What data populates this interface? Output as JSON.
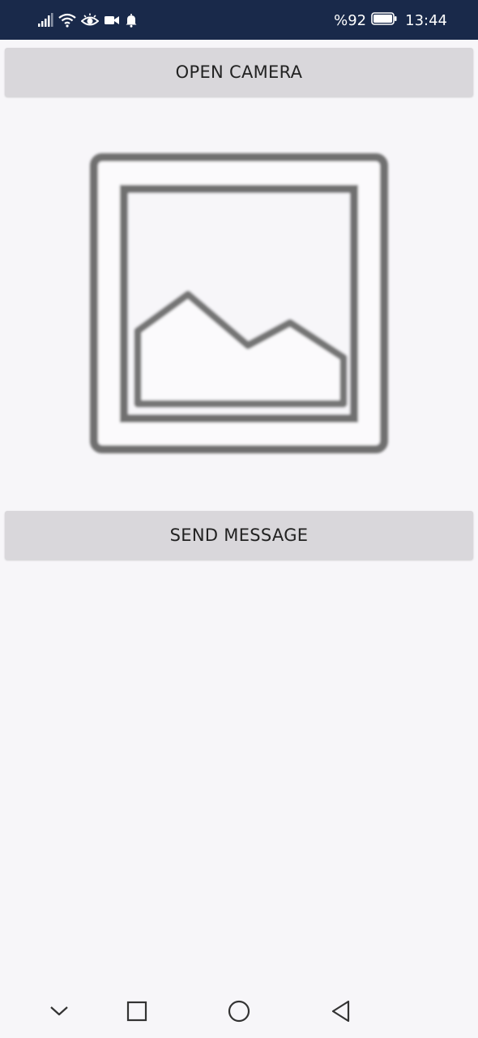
{
  "status_bar": {
    "battery_percent": "%92",
    "time": "13:44",
    "background_color": "#19294a",
    "icons": [
      "signal-icon",
      "wifi-icon",
      "eye-icon",
      "video-icon",
      "notification-bell-icon",
      "battery-icon"
    ]
  },
  "main": {
    "open_camera_label": "OPEN CAMERA",
    "send_message_label": "SEND MESSAGE",
    "image_placeholder_icon": "image-placeholder-icon",
    "button_color": "#d9d7db"
  },
  "nav_bar": {
    "icons": [
      "chevron-down-icon",
      "recent-apps-icon",
      "home-icon",
      "back-icon"
    ]
  }
}
